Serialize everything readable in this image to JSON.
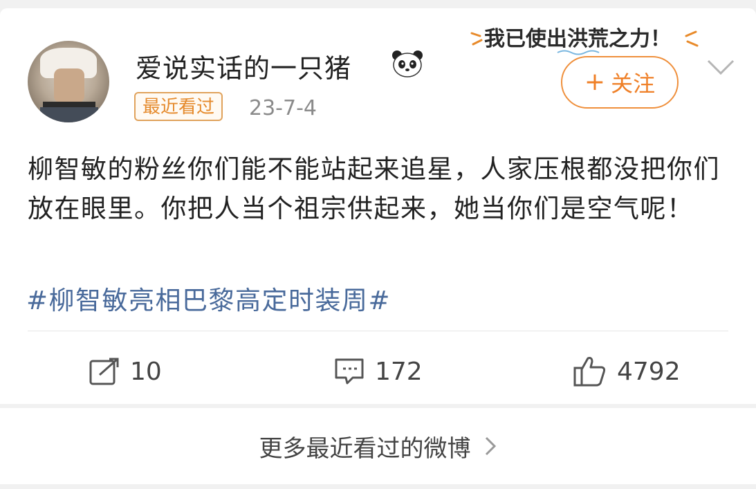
{
  "post": {
    "author": "爱说实话的一只猪",
    "badge": "最近看过",
    "date": "23-7-4",
    "follow_label": "关注",
    "text": "柳智敏的粉丝你们能不能站起来追星，人家压根都没把你们放在眼里。你把人当个祖宗供起来，她当你们是空气呢！",
    "hashtag": "#柳智敏亮相巴黎高定时装周#",
    "slogan": "我已使出洪荒之力！"
  },
  "actions": {
    "repost_count": "10",
    "comment_count": "172",
    "like_count": "4792"
  },
  "footer": {
    "more_label": "更多最近看过的微博"
  },
  "colors": {
    "accent_orange": "#ef7f26",
    "hashtag_blue": "#496a9b",
    "background": "#f1f1f1"
  },
  "icons": [
    "panda-icon",
    "plus-icon",
    "chevron-down-icon",
    "repost-icon",
    "comment-icon",
    "like-icon",
    "chevron-right-icon"
  ]
}
